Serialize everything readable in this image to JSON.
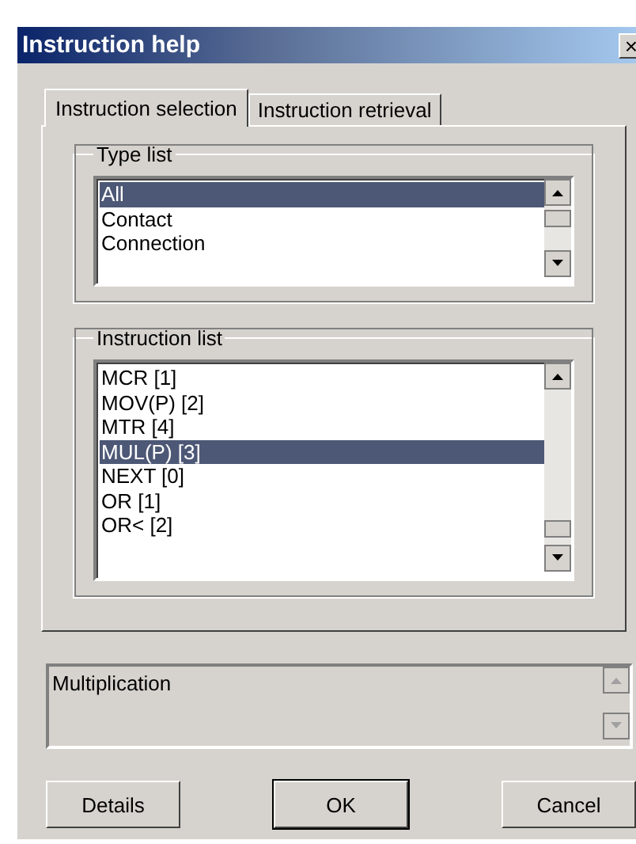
{
  "window": {
    "title": "Instruction help",
    "close": "×"
  },
  "tabs": [
    {
      "label": "Instruction selection",
      "selected": true
    },
    {
      "label": "Instruction retrieval",
      "selected": false
    }
  ],
  "type_list": {
    "title": "Type list",
    "items": [
      {
        "label": "All",
        "selected": true
      },
      {
        "label": "Contact",
        "selected": false
      },
      {
        "label": "Connection",
        "selected": false
      }
    ]
  },
  "instruction_list": {
    "title": "Instruction list",
    "items": [
      {
        "label": "MCR [1]",
        "selected": false
      },
      {
        "label": "MOV(P) [2]",
        "selected": false
      },
      {
        "label": "MTR [4]",
        "selected": false
      },
      {
        "label": "MUL(P) [3]",
        "selected": true
      },
      {
        "label": "NEXT [0]",
        "selected": false
      },
      {
        "label": "OR [1]",
        "selected": false
      },
      {
        "label": "OR< [2]",
        "selected": false
      }
    ]
  },
  "description": {
    "text": "Multiplication"
  },
  "buttons": [
    {
      "label": "Details",
      "default": false
    },
    {
      "label": "OK",
      "default": true
    },
    {
      "label": "Cancel",
      "default": false
    }
  ]
}
